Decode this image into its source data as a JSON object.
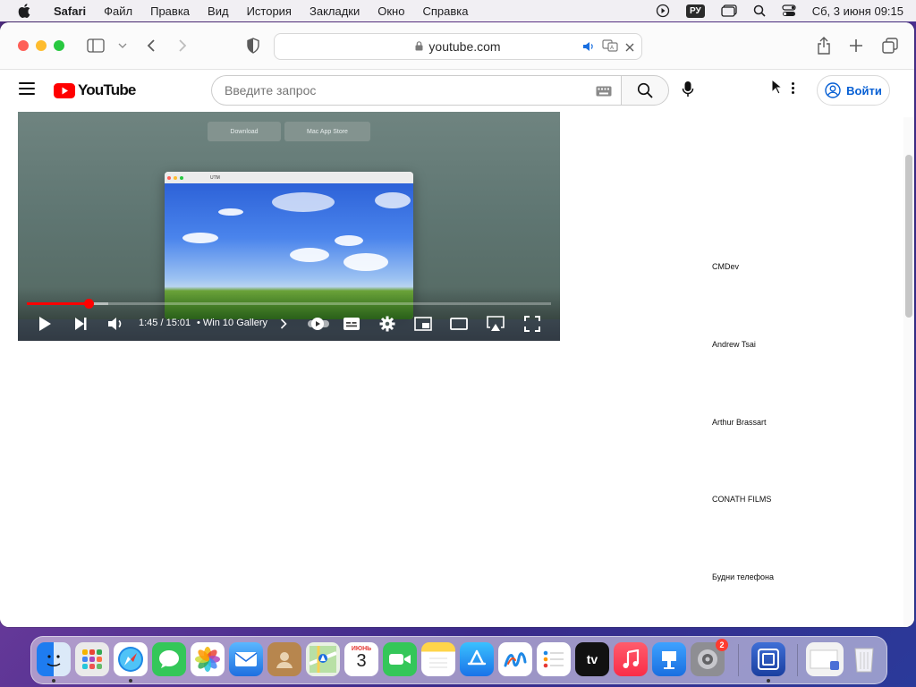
{
  "menubar": {
    "app_name": "Safari",
    "items": [
      "Файл",
      "Правка",
      "Вид",
      "История",
      "Закладки",
      "Окно",
      "Справка"
    ],
    "input_source": "РУ",
    "datetime": "Сб, 3 июня  09:15"
  },
  "browser": {
    "url": "youtube.com"
  },
  "youtube": {
    "logo_text": "YouTube",
    "search_placeholder": "Введите запрос",
    "signin_label": "Войти"
  },
  "player": {
    "download_label": "Download",
    "appstore_label": "Mac App Store",
    "vm_title": "UTM",
    "time": "1:45 / 15:01",
    "chapter": "• Win 10 Gallery",
    "progress_fraction": 0.117,
    "buffered_fraction": 0.155
  },
  "recommendations": [
    {
      "channel": "CMDev"
    },
    {
      "channel": "Andrew Tsai"
    },
    {
      "channel": "Arthur Brassart"
    },
    {
      "channel": "CONATH FILMS"
    },
    {
      "channel": "Будни телефона"
    }
  ],
  "dock": {
    "calendar_month": "ИЮНЬ",
    "calendar_day": "3",
    "settings_badge": "2",
    "tv_label": "tv"
  }
}
